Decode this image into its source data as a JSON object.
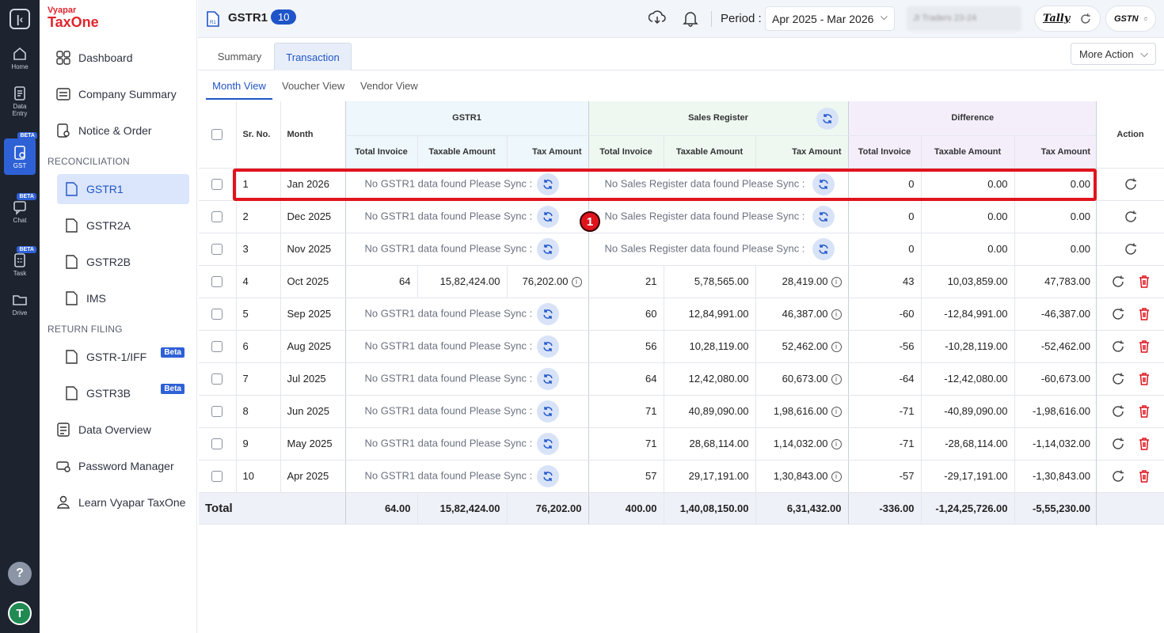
{
  "rail": {
    "items": [
      {
        "label": "Home"
      },
      {
        "label": "Data Entry"
      },
      {
        "label": "GST",
        "badge": "BETA"
      },
      {
        "label": "Chat",
        "badge": "BETA"
      },
      {
        "label": "Task",
        "badge": "BETA"
      },
      {
        "label": "Drive"
      }
    ],
    "help": "?",
    "avatar": "T"
  },
  "brand": {
    "line1": "Vyapar",
    "line2": "TaxOne"
  },
  "sidebar": {
    "dashboard": "Dashboard",
    "company_summary": "Company Summary",
    "notice_order": "Notice & Order",
    "section_reconciliation": "RECONCILIATION",
    "gstr1": "GSTR1",
    "gstr2a": "GSTR2A",
    "gstr2b": "GSTR2B",
    "ims": "IMS",
    "section_return_filing": "RETURN FILING",
    "gstr1_iff": "GSTR-1/IFF",
    "gstr1_iff_badge": "Beta",
    "gstr3b": "GSTR3B",
    "gstr3b_badge": "Beta",
    "data_overview": "Data Overview",
    "password_manager": "Password Manager",
    "learn": "Learn Vyapar TaxOne"
  },
  "topbar": {
    "title": "GSTR1",
    "count": "10",
    "period_label": "Period :",
    "period_value": "Apr 2025 - Mar 2026",
    "company": "JI Traders 23-24",
    "tally": "Tally",
    "gstn": "GSTN"
  },
  "tabs": {
    "summary": "Summary",
    "transaction": "Transaction",
    "more_action": "More Action"
  },
  "subtabs": {
    "month": "Month View",
    "voucher": "Voucher View",
    "vendor": "Vendor View"
  },
  "table": {
    "head": {
      "sr": "Sr. No.",
      "month": "Month",
      "gstr1": "GSTR1",
      "sales": "Sales Register",
      "diff": "Difference",
      "action": "Action",
      "total_invoice": "Total Invoice",
      "taxable": "Taxable Amount",
      "tax": "Tax Amount"
    },
    "no_gstr1": "No GSTR1 data found Please Sync :",
    "no_sales": "No Sales Register data found Please Sync :",
    "rows": [
      {
        "sr": "1",
        "month": "Jan 2026",
        "g_inv": null,
        "g_tax": null,
        "g_amt": null,
        "s_inv": null,
        "s_tax": null,
        "s_amt": null,
        "d_inv": "0",
        "d_tax": "0.00",
        "d_amt": "0.00"
      },
      {
        "sr": "2",
        "month": "Dec 2025",
        "g_inv": null,
        "g_tax": null,
        "g_amt": null,
        "s_inv": null,
        "s_tax": null,
        "s_amt": null,
        "d_inv": "0",
        "d_tax": "0.00",
        "d_amt": "0.00"
      },
      {
        "sr": "3",
        "month": "Nov 2025",
        "g_inv": null,
        "g_tax": null,
        "g_amt": null,
        "s_inv": null,
        "s_tax": null,
        "s_amt": null,
        "d_inv": "0",
        "d_tax": "0.00",
        "d_amt": "0.00"
      },
      {
        "sr": "4",
        "month": "Oct 2025",
        "g_inv": "64",
        "g_tax": "15,82,424.00",
        "g_amt": "76,202.00",
        "s_inv": "21",
        "s_tax": "5,78,565.00",
        "s_amt": "28,419.00",
        "d_inv": "43",
        "d_tax": "10,03,859.00",
        "d_amt": "47,783.00"
      },
      {
        "sr": "5",
        "month": "Sep 2025",
        "g_inv": null,
        "g_tax": null,
        "g_amt": null,
        "s_inv": "60",
        "s_tax": "12,84,991.00",
        "s_amt": "46,387.00",
        "d_inv": "-60",
        "d_tax": "-12,84,991.00",
        "d_amt": "-46,387.00"
      },
      {
        "sr": "6",
        "month": "Aug 2025",
        "g_inv": null,
        "g_tax": null,
        "g_amt": null,
        "s_inv": "56",
        "s_tax": "10,28,119.00",
        "s_amt": "52,462.00",
        "d_inv": "-56",
        "d_tax": "-10,28,119.00",
        "d_amt": "-52,462.00"
      },
      {
        "sr": "7",
        "month": "Jul 2025",
        "g_inv": null,
        "g_tax": null,
        "g_amt": null,
        "s_inv": "64",
        "s_tax": "12,42,080.00",
        "s_amt": "60,673.00",
        "d_inv": "-64",
        "d_tax": "-12,42,080.00",
        "d_amt": "-60,673.00"
      },
      {
        "sr": "8",
        "month": "Jun 2025",
        "g_inv": null,
        "g_tax": null,
        "g_amt": null,
        "s_inv": "71",
        "s_tax": "40,89,090.00",
        "s_amt": "1,98,616.00",
        "d_inv": "-71",
        "d_tax": "-40,89,090.00",
        "d_amt": "-1,98,616.00"
      },
      {
        "sr": "9",
        "month": "May 2025",
        "g_inv": null,
        "g_tax": null,
        "g_amt": null,
        "s_inv": "71",
        "s_tax": "28,68,114.00",
        "s_amt": "1,14,032.00",
        "d_inv": "-71",
        "d_tax": "-28,68,114.00",
        "d_amt": "-1,14,032.00"
      },
      {
        "sr": "10",
        "month": "Apr 2025",
        "g_inv": null,
        "g_tax": null,
        "g_amt": null,
        "s_inv": "57",
        "s_tax": "29,17,191.00",
        "s_amt": "1,30,843.00",
        "d_inv": "-57",
        "d_tax": "-29,17,191.00",
        "d_amt": "-1,30,843.00"
      }
    ],
    "total": {
      "label": "Total",
      "g_inv": "64.00",
      "g_tax": "15,82,424.00",
      "g_amt": "76,202.00",
      "s_inv": "400.00",
      "s_tax": "1,40,08,150.00",
      "s_amt": "6,31,432.00",
      "d_inv": "-336.00",
      "d_tax": "-1,24,25,726.00",
      "d_amt": "-5,55,230.00"
    }
  },
  "annotation": {
    "marker": "1",
    "color": "#e0141d"
  },
  "colors": {
    "accent": "#1f55c8",
    "delete": "#e0141d",
    "rail": "#1d2430"
  }
}
